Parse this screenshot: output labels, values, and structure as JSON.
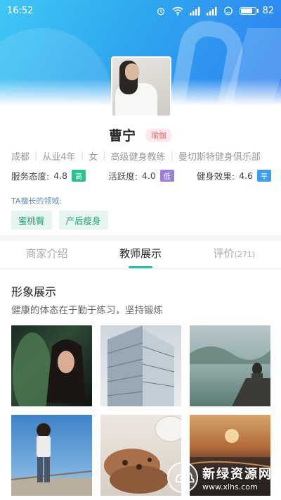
{
  "status_bar": {
    "time": "16:52",
    "battery": "82",
    "battery_level": 0.82
  },
  "profile": {
    "name": "曹宁",
    "category_tag": "瑜伽",
    "info": [
      "成都",
      "从业4年",
      "女",
      "高级健身教练",
      "曼切斯特健身俱乐部"
    ],
    "stats": [
      {
        "label": "服务态度:",
        "value": "4.8",
        "badge": "高",
        "badge_color": "#29c48e"
      },
      {
        "label": "活跃度:",
        "value": "4.0",
        "badge": "低",
        "badge_color": "#9b7fdb"
      },
      {
        "label": "健身效果:",
        "value": "4.6",
        "badge": "平",
        "badge_color": "#3d9ef0"
      }
    ],
    "expertise_title": "TA擅长的领域:",
    "expertise_tags": [
      "蜜桃臀",
      "产后瘦身"
    ]
  },
  "tabs": [
    {
      "label": "商家介绍",
      "count": ""
    },
    {
      "label": "教师展示",
      "count": ""
    },
    {
      "label": "评价",
      "count": "(271)"
    }
  ],
  "active_tab": 1,
  "showcase": {
    "title": "形象展示",
    "desc": "健康的体态在于勤于练习，坚持锻炼",
    "photos": [
      "photo-1",
      "photo-2",
      "photo-3",
      "photo-4",
      "photo-5",
      "photo-6"
    ]
  },
  "watermark": {
    "title": "新绿资源网",
    "url": "www.xlhs.com"
  }
}
